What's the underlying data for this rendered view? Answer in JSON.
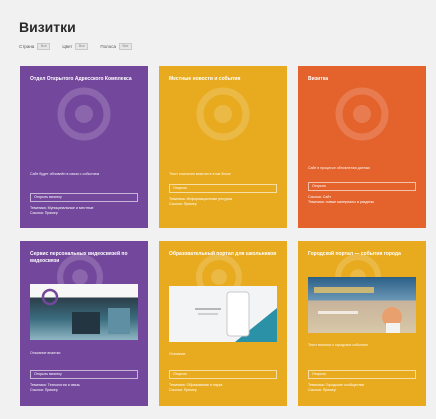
{
  "page": {
    "title": "Визитки"
  },
  "filters": [
    {
      "label": "Страна",
      "value": "Все"
    },
    {
      "label": "Цвет",
      "value": "Все"
    },
    {
      "label": "Полоса",
      "value": "Все"
    }
  ],
  "colors": {
    "purple": "#73479c",
    "yellow": "#e8ab1f",
    "orange": "#e4622c",
    "background": "#f1f1f1"
  },
  "cards": [
    {
      "title": "Отдел Открытого Адресского Комплекса",
      "desc": "Сайт будет обновлён в связи с событием",
      "tag": "Открыть визитку",
      "meta1": "Тематика: Муниципальные и местные",
      "meta2": "Ссылка: Пример",
      "thumb": ""
    },
    {
      "title": "Местные новости и события",
      "desc": "Текст описания визитки в этом блоке",
      "tag": "Открыть",
      "meta1": "Тематика: Информационные ресурсы",
      "meta2": "Ссылка: Пример",
      "thumb": ""
    },
    {
      "title": "Визитка",
      "desc": "Сайт в процессе обновления данных",
      "tag": "Открыть",
      "meta1": "Ссылка: Сайт",
      "meta2": "Тематика: новые материалы и разделы",
      "thumb": ""
    },
    {
      "title": "Сервис персональных видеосвязей по видеосвязи",
      "desc": "Описание визитки",
      "tag": "Открыть визитку",
      "meta1": "Тематика: Технологии и связь",
      "meta2": "Ссылка: Пример",
      "thumb": "a"
    },
    {
      "title": "Образовательный портал для школьников",
      "desc": "Описание",
      "tag": "Открыть",
      "meta1": "Тематика: Образование и наука",
      "meta2": "Ссылка: Пример",
      "thumb": "b"
    },
    {
      "title": "Городской портал — события города",
      "desc": "Текст визитки о городских событиях",
      "tag": "Открыть",
      "meta1": "Тематика: Городские сообщества",
      "meta2": "Ссылка: Пример",
      "thumb": "c"
    }
  ]
}
